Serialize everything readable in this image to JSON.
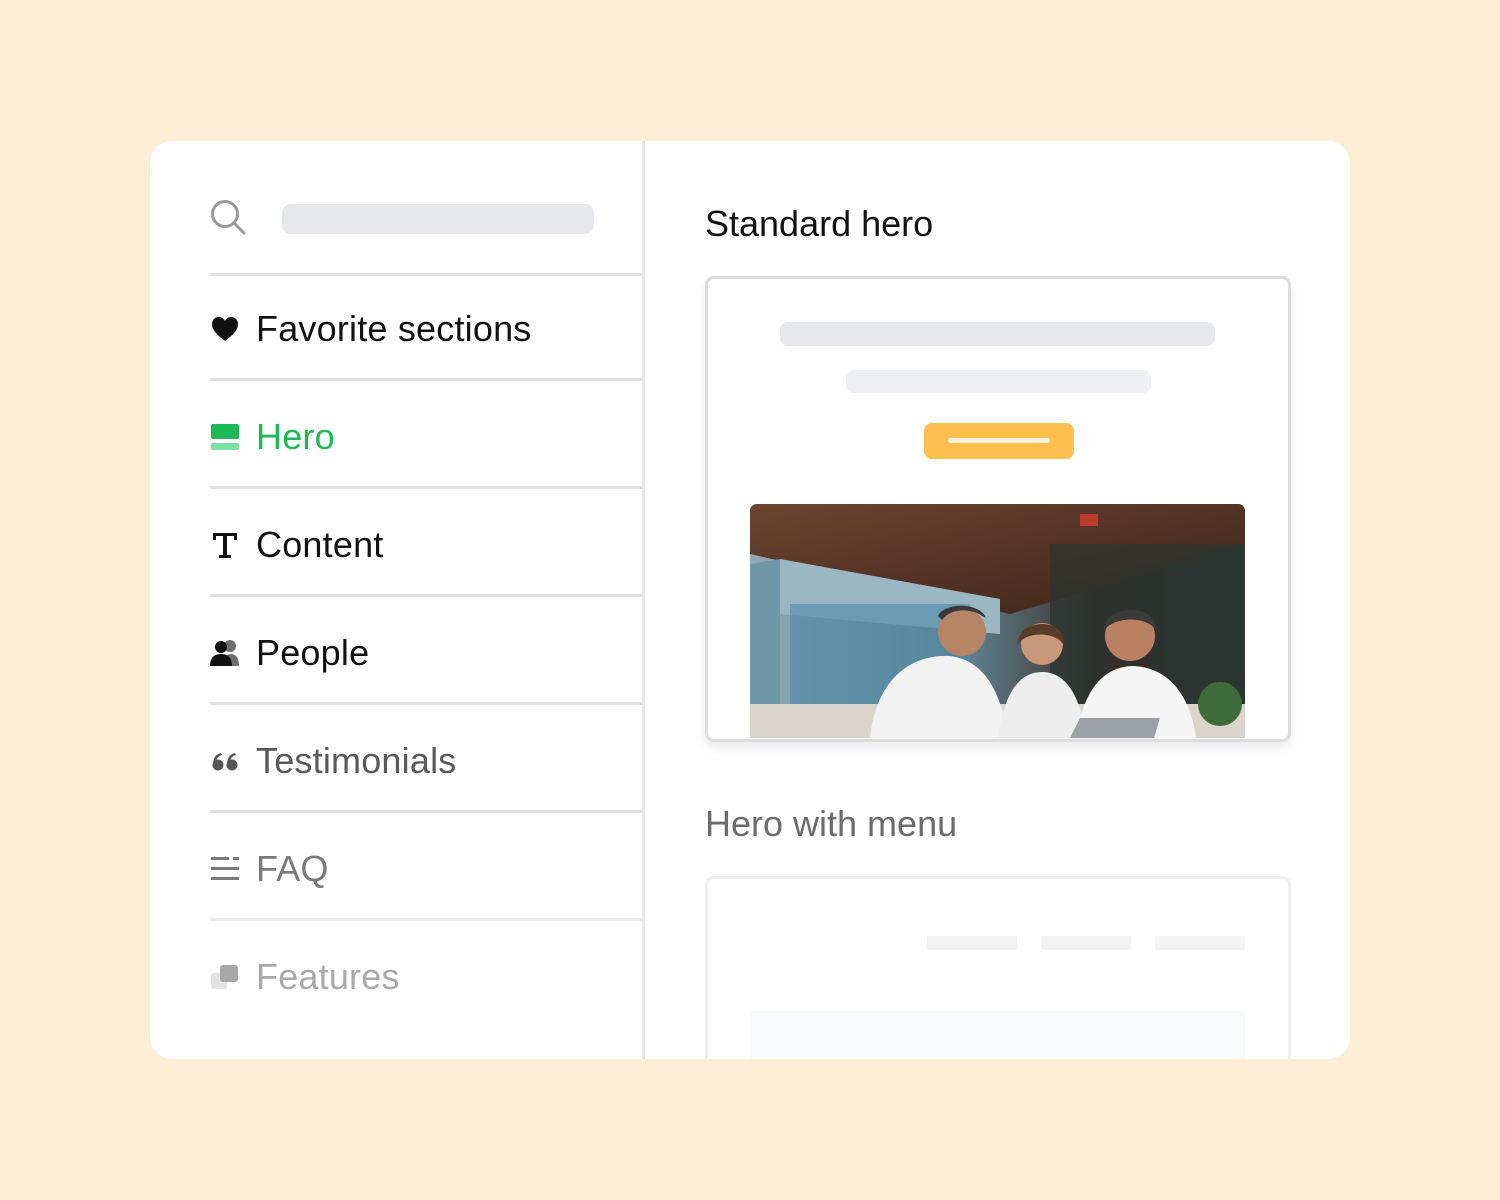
{
  "sidebar": {
    "search": {
      "placeholder": ""
    },
    "items": [
      {
        "label": "Favorite sections",
        "icon": "heart-icon"
      },
      {
        "label": "Hero",
        "icon": "hero-layout-icon",
        "active": true
      },
      {
        "label": "Content",
        "icon": "text-icon"
      },
      {
        "label": "People",
        "icon": "people-icon"
      },
      {
        "label": "Testimonials",
        "icon": "quote-icon"
      },
      {
        "label": "FAQ",
        "icon": "list-icon"
      },
      {
        "label": "Features",
        "icon": "features-icon"
      }
    ]
  },
  "main": {
    "sections": [
      {
        "title": "Standard hero"
      },
      {
        "title": "Hero with menu"
      }
    ]
  },
  "colors": {
    "background": "#FFEED5",
    "accent": "#1DB954",
    "cta": "#FFBF4F"
  }
}
